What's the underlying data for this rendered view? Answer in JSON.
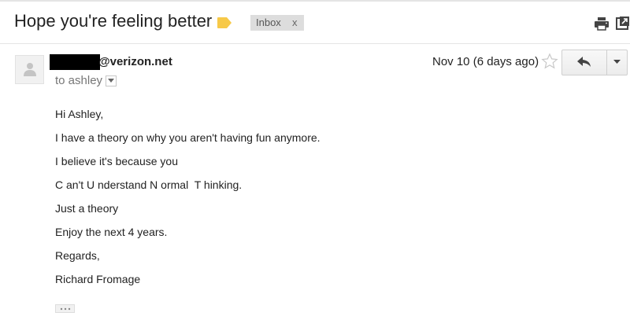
{
  "email": {
    "subject": "Hope you're feeling better",
    "label_chip": {
      "text": "Inbox",
      "remove": "x"
    },
    "sender_domain": "@verizon.net",
    "to_line": "to ashley",
    "date": "Nov 10 (6 days ago)",
    "body_lines": [
      "Hi Ashley,",
      "I have a theory on why you aren't having fun anymore.",
      "I believe it's because you",
      "C an't U nderstand N ormal  T hinking.",
      "Just a theory",
      "Enjoy the next 4 years.",
      "Regards,",
      "Richard Fromage"
    ]
  },
  "icons": {
    "label": "label-tag-icon",
    "print": "print-icon",
    "popout": "new-window-icon",
    "avatar": "person-icon",
    "star": "star-icon",
    "reply": "reply-arrow-icon",
    "more": "chevron-down-icon",
    "trimmed": "ellipsis-icon"
  },
  "colors": {
    "label_tag": "#f7c948",
    "chip_bg": "#dddddd",
    "redaction": "#000000"
  }
}
